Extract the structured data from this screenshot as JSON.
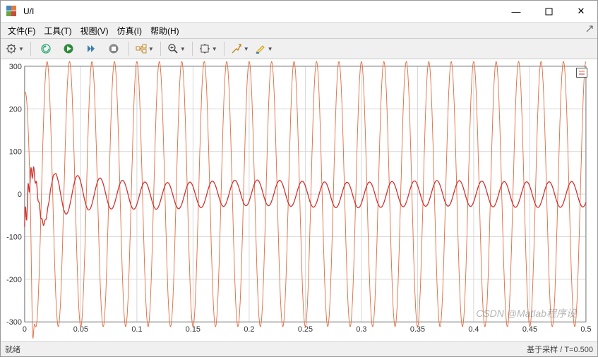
{
  "window": {
    "title": "U/I"
  },
  "menu": {
    "file": "文件(F)",
    "tools": "工具(T)",
    "view": "视图(V)",
    "simulation": "仿真(I)",
    "help": "帮助(H)"
  },
  "status": {
    "left": "就绪",
    "right": "基于采样 / T=0.500"
  },
  "watermark": "CSDN @Matlab程序设",
  "chart_data": {
    "type": "line",
    "xlabel": "",
    "ylabel": "",
    "xlim": [
      0,
      0.5
    ],
    "ylim": [
      -300,
      300
    ],
    "x_ticks": [
      0,
      0.05,
      0.1,
      0.15,
      0.2,
      0.25,
      0.3,
      0.35,
      0.4,
      0.45,
      0.5
    ],
    "y_ticks": [
      -300,
      -200,
      -100,
      0,
      100,
      200,
      300
    ],
    "series": [
      {
        "name": "U",
        "color": "#e06a3c",
        "description": "Sinusoidal voltage, 50 Hz, amplitude ≈ 311, initial transient dip near t≈0.007",
        "frequency_hz": 50,
        "amplitude_initial": 311,
        "amplitude_steady": 311,
        "phase_deg": 90
      },
      {
        "name": "I",
        "color": "#d1322e",
        "description": "Current response: start-up ringing (peaks ≈ ±80..60) decaying to steady sinusoid amplitude ≈ 30 after t≈0.1, with small low-freq ripple and slight DC sag in first 3 cycles",
        "frequency_hz": 50,
        "amplitude_initial": 80,
        "amplitude_steady": 30,
        "settle_time": 0.1
      }
    ]
  }
}
